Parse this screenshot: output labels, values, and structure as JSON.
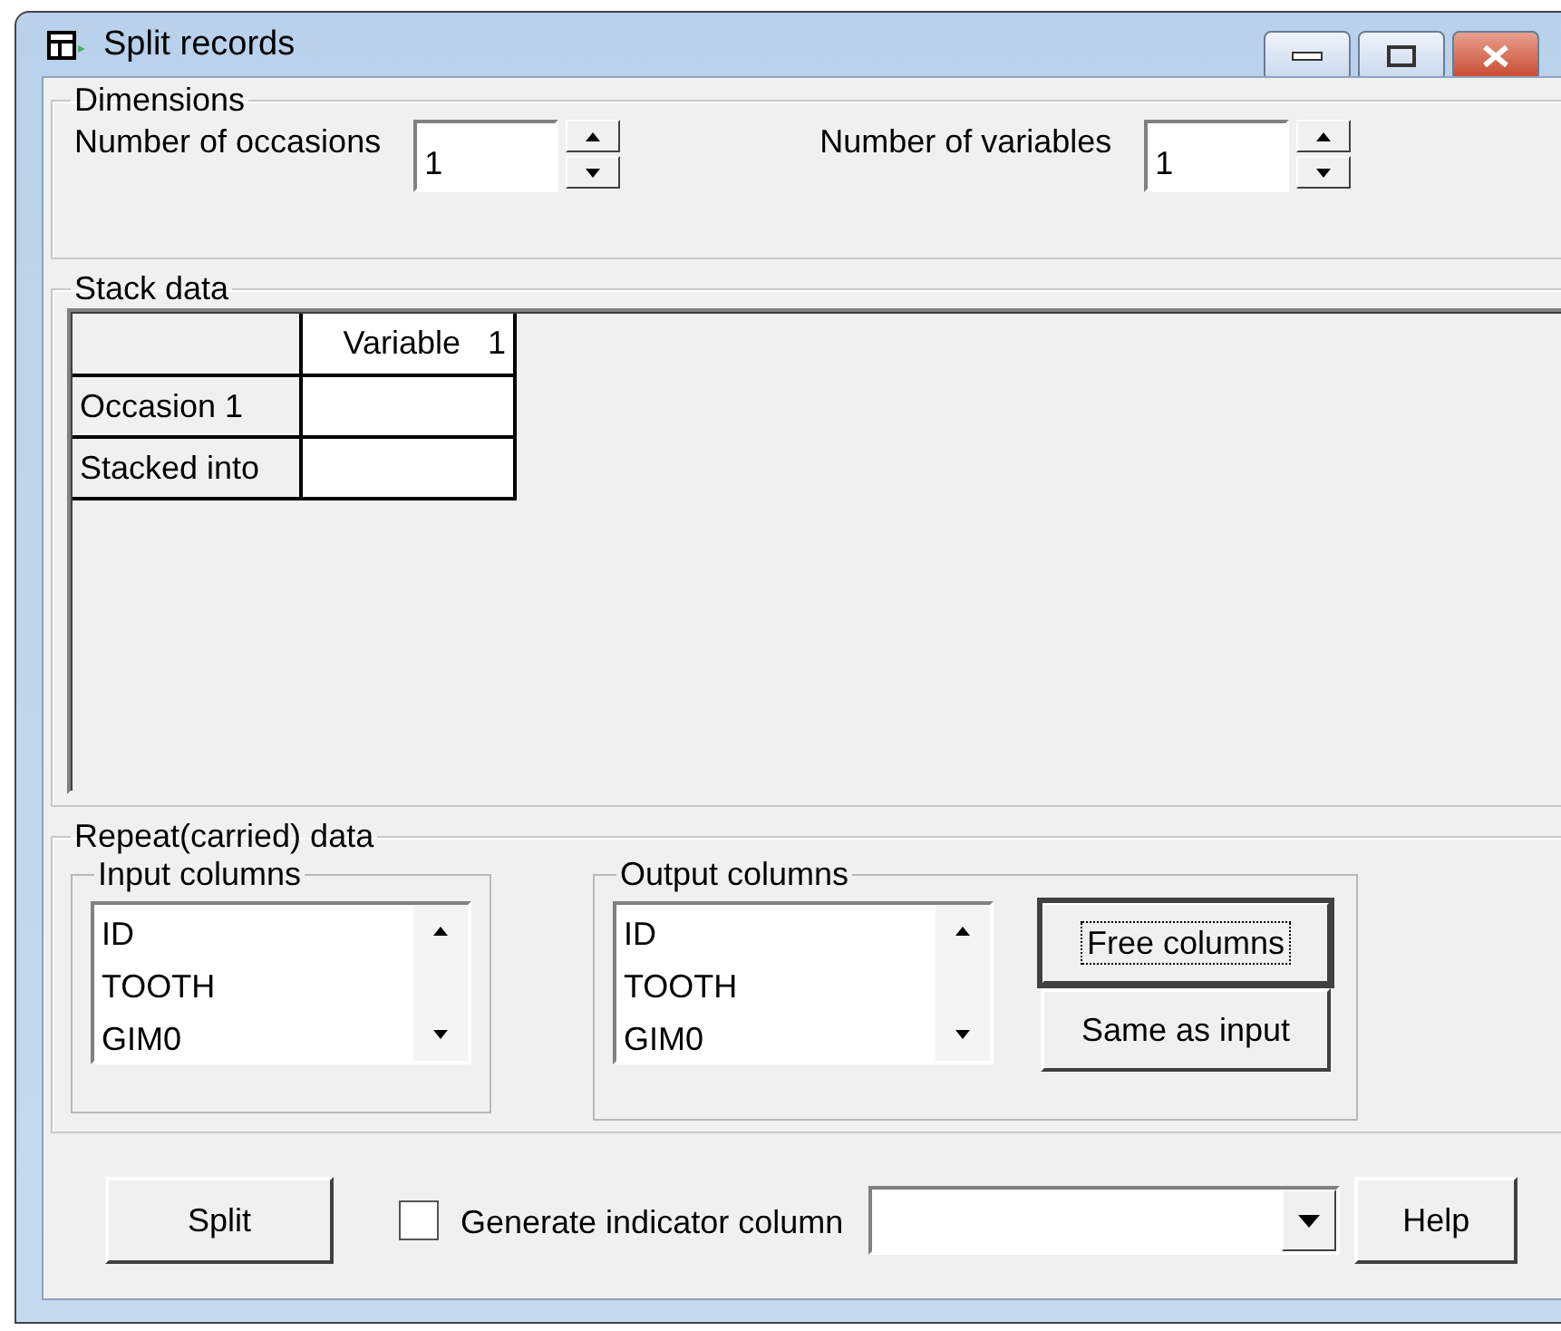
{
  "window": {
    "title": "Split records"
  },
  "dimensions": {
    "title": "Dimensions",
    "fields": [
      {
        "label": "Number of occasions",
        "value": "1"
      },
      {
        "label": "Number of variables",
        "value": "1"
      }
    ]
  },
  "stack_data": {
    "title": "Stack data",
    "columns": [
      "Variable   1"
    ],
    "rows": [
      {
        "header": "Occasion 1",
        "cells": [
          ""
        ]
      },
      {
        "header": "Stacked into",
        "cells": [
          ""
        ]
      }
    ]
  },
  "repeat_data": {
    "title": "Repeat(carried) data",
    "lists": [
      {
        "title": "Input columns",
        "items": [
          "ID",
          "TOOTH",
          "GIM0"
        ]
      },
      {
        "title": "Output columns",
        "items": [
          "ID",
          "TOOTH",
          "GIM0"
        ]
      }
    ],
    "buttons": [
      {
        "label": "Free columns",
        "focused": true
      },
      {
        "label": "Same as input",
        "focused": false
      }
    ]
  },
  "footer": {
    "split_button": "Split",
    "indicator": {
      "label": "Generate indicator column",
      "checked": false
    },
    "help_button": "Help"
  }
}
